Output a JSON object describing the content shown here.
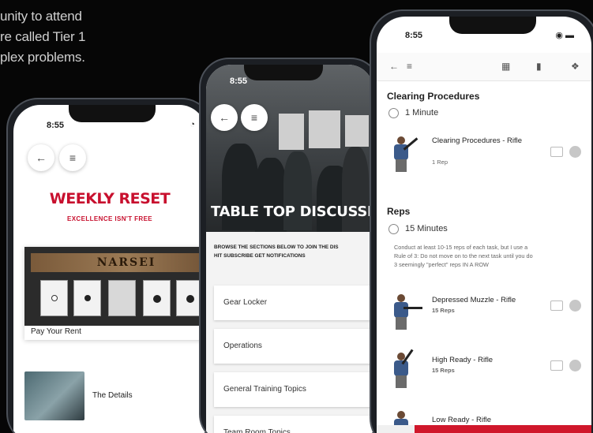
{
  "headline": {
    "lines": [
      "unity to attend",
      "re called Tier 1",
      "plex problems."
    ]
  },
  "phone1": {
    "time": "8:55",
    "status": "◔",
    "back_icon": "←",
    "menu_icon": "≡",
    "title": "WEEKLY RESET",
    "subtitle": "EXCELLENCE ISN'T FREE",
    "card1": {
      "sign_text": "NARSEI",
      "label": "Pay Your Rent"
    },
    "card2": {
      "label": "The Details"
    }
  },
  "phone2": {
    "time": "8:55",
    "back_icon": "←",
    "menu_icon": "≡",
    "hero_title": "TABLE TOP DISCUSSI",
    "intro_lines": [
      "BROWSE THE SECTIONS BELOW TO JOIN THE DIS",
      "HIT SUBSCRIBE GET NOTIFICATIONS"
    ],
    "items": [
      "Gear Locker",
      "Operations",
      "General Training Topics",
      "Team Room Topics"
    ]
  },
  "phone3": {
    "time": "8:55",
    "status": "◉ ▬",
    "toolbar": {
      "back": "←",
      "menu": "≡",
      "calendar": "▦",
      "bookmark": "▮",
      "more": "❖"
    },
    "section1": {
      "title": "Clearing Procedures",
      "duration": "1 Minute",
      "exercises": [
        {
          "name": "Clearing Procedures - Rifle",
          "reps": "1 Rep"
        }
      ]
    },
    "section2": {
      "title": "Reps",
      "duration": "15 Minutes",
      "description_lines": [
        "Conduct at least 10-15 reps of each task, but I use a",
        "Rule of 3: Do not move on to the next task until you do",
        "3 seemingly \"perfect\" reps IN A ROW"
      ],
      "exercises": [
        {
          "name": "Depressed Muzzle - Rifle",
          "reps": "15 Reps"
        },
        {
          "name": "High Ready - Rifle",
          "reps": "15 Reps"
        },
        {
          "name": "Low Ready - Rifle",
          "reps": ""
        }
      ]
    },
    "bottom_icon": "⇄",
    "accent_color": "#d0172b"
  }
}
